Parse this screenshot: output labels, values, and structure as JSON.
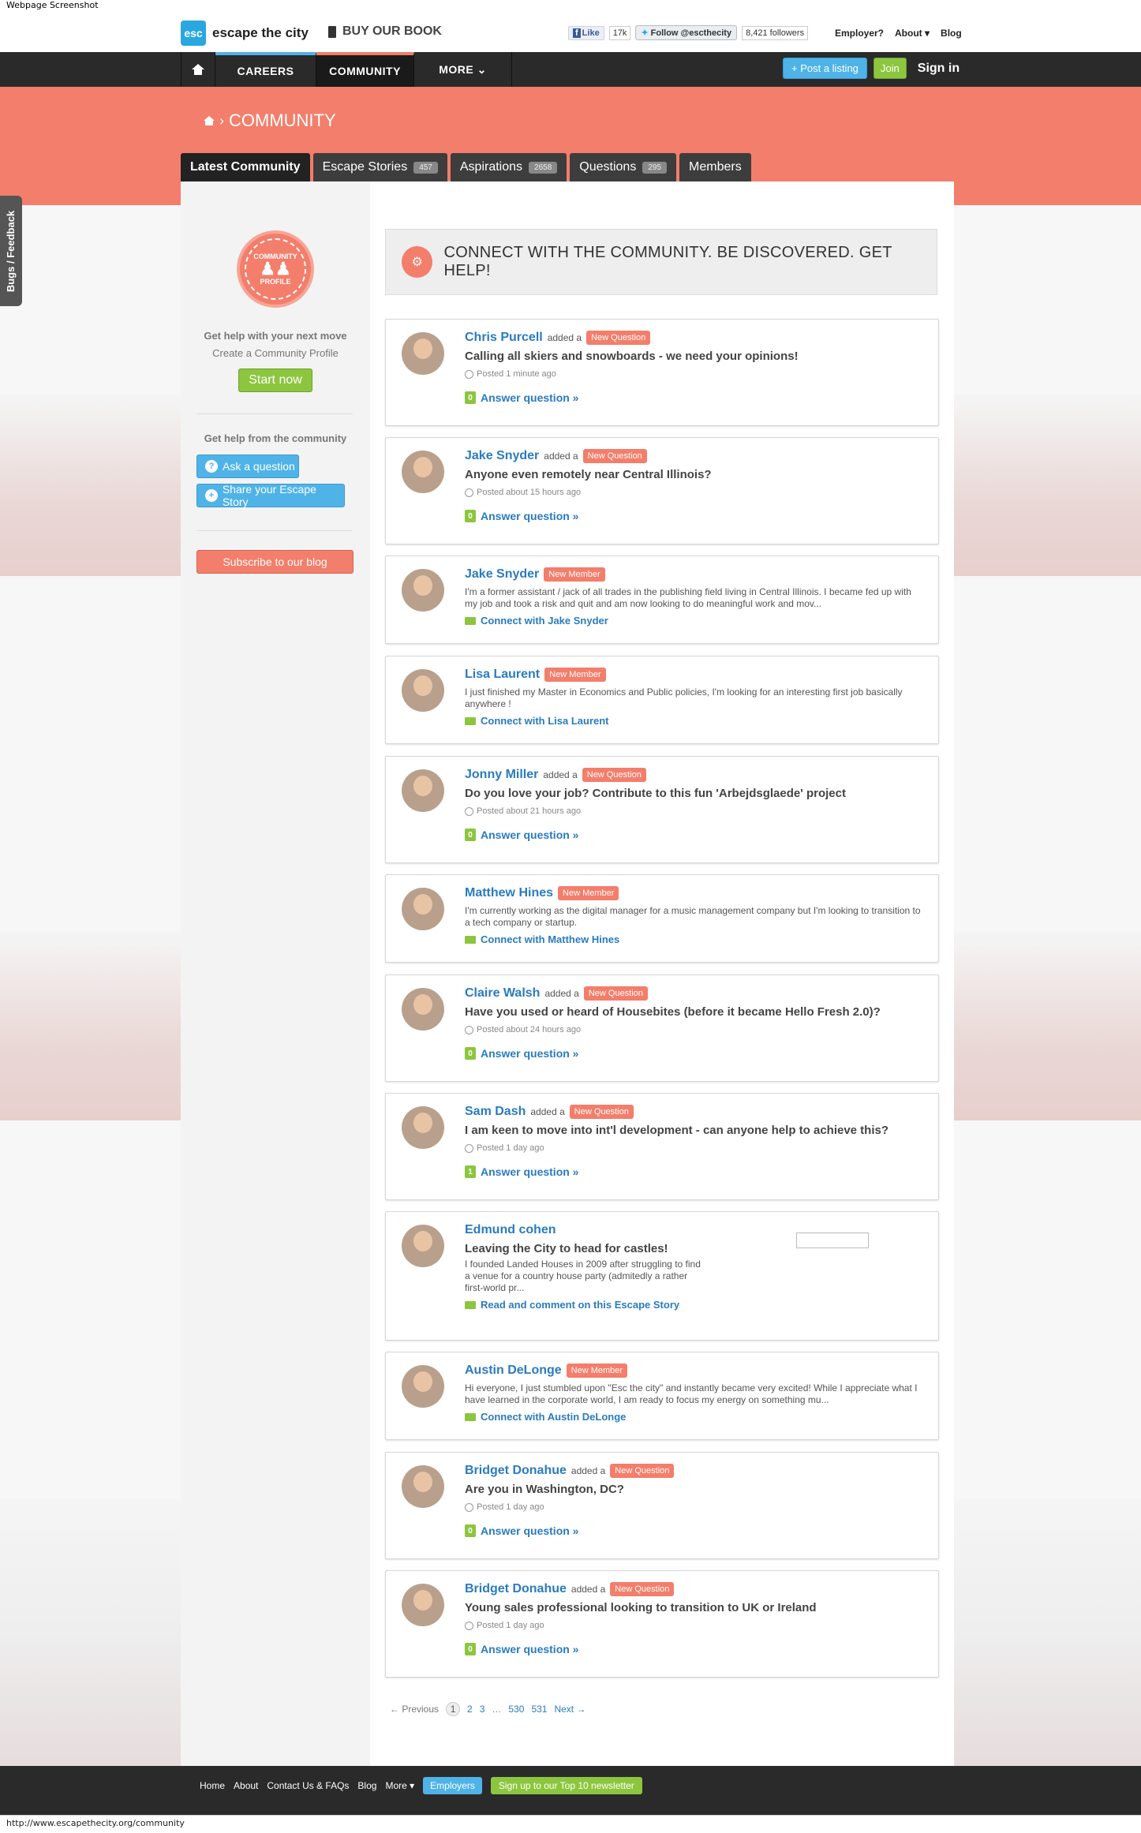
{
  "window": {
    "caption": "Webpage Screenshot",
    "status_url": "http://www.escapethecity.org/community"
  },
  "header": {
    "logo_mark": "esc",
    "logo_text": "escape the city",
    "book_label": "BUY OUR BOOK",
    "fb_like": "Like",
    "fb_count": "17k",
    "tw_follow": "Follow @escthecity",
    "tw_followers": "8,421 followers",
    "links": [
      "Employer?",
      "About ▾",
      "Blog"
    ]
  },
  "nav": {
    "items": [
      "CAREERS",
      "COMMUNITY",
      "MORE ⌄"
    ],
    "post_listing": "+ Post a listing",
    "join": "Join",
    "sign_in": "Sign in"
  },
  "page": {
    "breadcrumb": "COMMUNITY",
    "tabs": [
      {
        "label": "Latest Community",
        "count": ""
      },
      {
        "label": "Escape Stories",
        "count": "457"
      },
      {
        "label": "Aspirations",
        "count": "2658"
      },
      {
        "label": "Questions",
        "count": "295"
      },
      {
        "label": "Members",
        "count": ""
      }
    ]
  },
  "sidebar": {
    "seal_top": "COMMUNITY",
    "seal_bottom": "PROFILE",
    "help_move_title": "Get help with your next move",
    "help_move_sub": "Create a Community Profile",
    "start_now": "Start now",
    "help_community_title": "Get help from the community",
    "ask_question": "Ask a question",
    "share_story": "Share your Escape Story",
    "subscribe": "Subscribe to our blog",
    "feedback_tab": "Bugs / Feedback"
  },
  "main": {
    "connect_banner": "CONNECT WITH THE COMMUNITY. BE DISCOVERED. GET HELP!",
    "cards": [
      {
        "name": "Chris Purcell",
        "added": "added a",
        "tag": "New Question",
        "title": "Calling all skiers and snowboards - we need your opinions!",
        "posted": "Posted 1 minute ago",
        "count": "0",
        "link": "Answer question »"
      },
      {
        "name": "Jake Snyder",
        "added": "added a",
        "tag": "New Question",
        "title": "Anyone even remotely near Central Illinois?",
        "posted": "Posted about 15 hours ago",
        "count": "0",
        "link": "Answer question »"
      },
      {
        "name": "Jake Snyder",
        "tag": "New Member",
        "desc": "I'm a former assistant / jack of all trades in the publishing field living in Central Illinois. I became fed up with my job and took a risk and quit and am now looking to do meaningful work and mov...",
        "link": "Connect with Jake Snyder"
      },
      {
        "name": "Lisa Laurent",
        "tag": "New Member",
        "desc": "I just finished my Master in Economics and Public policies, I'm looking for an interesting first job basically anywhere !",
        "link": "Connect with Lisa Laurent"
      },
      {
        "name": "Jonny Miller",
        "added": "added a",
        "tag": "New Question",
        "title": "Do you love your job? Contribute to this fun 'Arbejdsglaede' project",
        "posted": "Posted about 21 hours ago",
        "count": "0",
        "link": "Answer question »"
      },
      {
        "name": "Matthew Hines",
        "tag": "New Member",
        "desc": "I'm currently working as the digital manager for a music management company but I'm looking to transition to a tech company or startup.",
        "link": "Connect with Matthew Hines"
      },
      {
        "name": "Claire Walsh",
        "added": "added a",
        "tag": "New Question",
        "title": "Have you used or heard of Housebites (before it became Hello Fresh 2.0)?",
        "posted": "Posted about 24 hours ago",
        "count": "0",
        "link": "Answer question »"
      },
      {
        "name": "Sam Dash",
        "added": "added a",
        "tag": "New Question",
        "title": "I am keen to move into int'l development - can anyone help to achieve this?",
        "posted": "Posted 1 day ago",
        "count": "1",
        "link": "Answer question »"
      },
      {
        "name": "Edmund cohen",
        "title": "Leaving the City to head for castles!",
        "desc": "I founded Landed Houses in 2009 after struggling to find a venue for a country house party (admitedly a rather first-world pr...",
        "link": "Read and comment on this Escape Story"
      },
      {
        "name": "Austin DeLonge",
        "tag": "New Member",
        "desc": "Hi everyone, I just stumbled upon \"Esc the city\" and instantly became very excited! While I appreciate what I have learned in the corporate world, I am ready to focus my energy on something mu...",
        "link": "Connect with Austin DeLonge"
      },
      {
        "name": "Bridget Donahue",
        "added": "added a",
        "tag": "New Question",
        "title": "Are you in Washington, DC?",
        "posted": "Posted 1 day ago",
        "count": "0",
        "link": "Answer question »"
      },
      {
        "name": "Bridget Donahue",
        "added": "added a",
        "tag": "New Question",
        "title": "Young sales professional looking to transition to UK or Ireland",
        "posted": "Posted 1 day ago",
        "count": "0",
        "link": "Answer question »"
      }
    ],
    "pagination": {
      "prev": "← Previous",
      "pages": [
        "1",
        "2",
        "3",
        "…",
        "530",
        "531"
      ],
      "next": "Next →"
    }
  },
  "footer": {
    "links": [
      "Home",
      "About",
      "Contact Us & FAQs",
      "Blog",
      "More ▾"
    ],
    "employers": "Employers",
    "newsletter": "Sign up to our Top 10 newsletter"
  },
  "colors": {
    "accent_coral": "#f37e6b",
    "accent_blue": "#4fb3e8",
    "accent_green": "#8cc63f",
    "nav_dark": "#2a2a2a",
    "link_blue": "#2a7bc0"
  }
}
